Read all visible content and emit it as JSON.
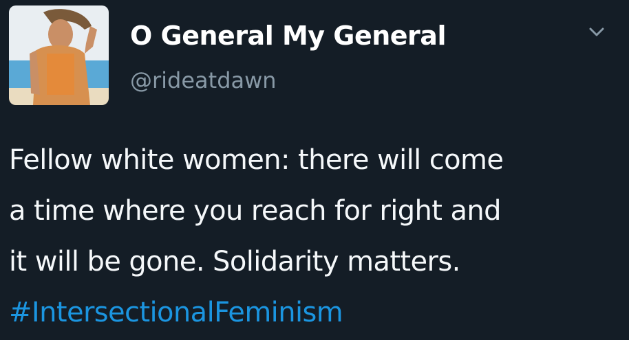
{
  "tweet": {
    "author": {
      "display_name": "O General My General",
      "handle": "@rideatdawn",
      "avatar_icon": "avatar-photo"
    },
    "menu_icon": "chevron-down-icon",
    "text_lines": [
      "Fellow white women: there will come",
      "a time where you reach for right and",
      "it will be gone. Solidarity matters."
    ],
    "hashtag": "#IntersectionalFeminism"
  },
  "colors": {
    "background": "#141d26",
    "text": "#f5f8fa",
    "handle": "#8899a6",
    "link": "#1b95e0"
  }
}
